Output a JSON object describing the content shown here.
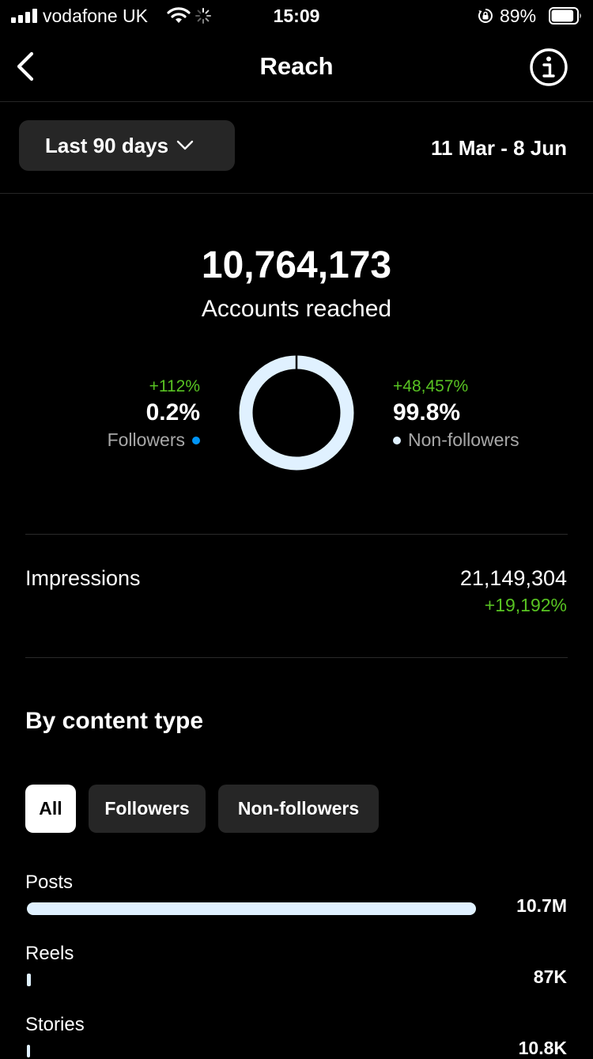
{
  "status_bar": {
    "carrier": "vodafone UK",
    "time": "15:09",
    "battery_percent": "89%",
    "signal_icon": "signal-bars-icon",
    "wifi_icon": "wifi-icon",
    "activity_icon": "activity-spinner-icon",
    "rotation_lock_icon": "rotation-lock-icon",
    "battery_icon": "battery-icon",
    "battery_level": 0.89
  },
  "nav": {
    "title": "Reach",
    "back_icon": "chevron-left-icon",
    "info_icon": "info-icon"
  },
  "range": {
    "selected": "Last 90 days",
    "dropdown_icon": "chevron-down-icon",
    "dates": "11 Mar - 8 Jun"
  },
  "reach": {
    "total": "10,764,173",
    "label": "Accounts reached",
    "followers": {
      "change": "+112%",
      "percent": "0.2%",
      "label": "Followers",
      "color": "#0095f6"
    },
    "non_followers": {
      "change": "+48,457%",
      "percent": "99.8%",
      "label": "Non-followers",
      "color": "#e0f1ff"
    },
    "donut": {
      "followers_share": 0.002,
      "non_followers_share": 0.998
    }
  },
  "impressions": {
    "label": "Impressions",
    "value": "21,149,304",
    "change": "+19,192%"
  },
  "by_content_type": {
    "title": "By content type",
    "filters": [
      {
        "label": "All",
        "selected": true
      },
      {
        "label": "Followers",
        "selected": false
      },
      {
        "label": "Non-followers",
        "selected": false
      }
    ],
    "rows": [
      {
        "label": "Posts",
        "value": "10.7M",
        "amount": 10700000
      },
      {
        "label": "Reels",
        "value": "87K",
        "amount": 87000
      },
      {
        "label": "Stories",
        "value": "10.8K",
        "amount": 10800
      }
    ]
  },
  "colors": {
    "background": "#000000",
    "surface": "#262626",
    "positive": "#58c322",
    "followers_blue": "#0095f6",
    "non_followers_light": "#e0f1ff",
    "secondary_text": "#a8a8a8"
  }
}
